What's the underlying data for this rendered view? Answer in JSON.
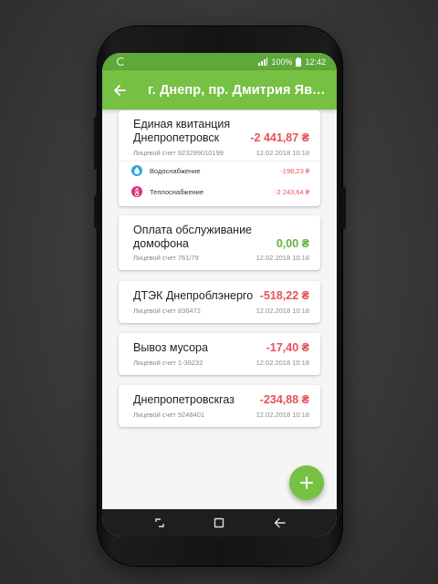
{
  "status": {
    "battery": "100%",
    "time": "12:42"
  },
  "appbar": {
    "title": "г. Днепр, пр. Дмитрия Яворницкого"
  },
  "currency_symbol": "₴",
  "bills": [
    {
      "name": "Единая квитанция Днепропетровск",
      "amount": "-2 441,87 ₴",
      "account": "Лицевой счет 923299010199",
      "date": "12.02.2018 10:18",
      "services": [
        {
          "label": "Водоснабжение",
          "amount": "-198,23 ₴",
          "icon": "water-drop-icon",
          "color": "#2aa6e0"
        },
        {
          "label": "Теплоснабжение",
          "amount": "-2 243,64 ₴",
          "icon": "thermometer-icon",
          "color": "#e0307a"
        }
      ]
    },
    {
      "name": "Оплата обслуживание домофона",
      "amount": "0,00 ₴",
      "account": "Лицевой счет 761/79",
      "date": "12.02.2018 10:18"
    },
    {
      "name": "ДТЭК Днепроблэнерго",
      "amount": "-518,22 ₴",
      "account": "Лицевой счет 836472",
      "date": "12.02.2018 10:18"
    },
    {
      "name": "Вывоз мусора",
      "amount": "-17,40 ₴",
      "account": "Лицевой счет 1-36232",
      "date": "12.02.2018 10:18"
    },
    {
      "name": "Днепропетровскгаз",
      "amount": "-234,88 ₴",
      "account": "Лицевой счет 9248401",
      "date": "12.02.2018 10:18"
    }
  ],
  "colors": {
    "appbar": "#76c043",
    "statusbar": "#5fa83a",
    "negative": "#e8505b",
    "positive": "#5fb53c"
  }
}
